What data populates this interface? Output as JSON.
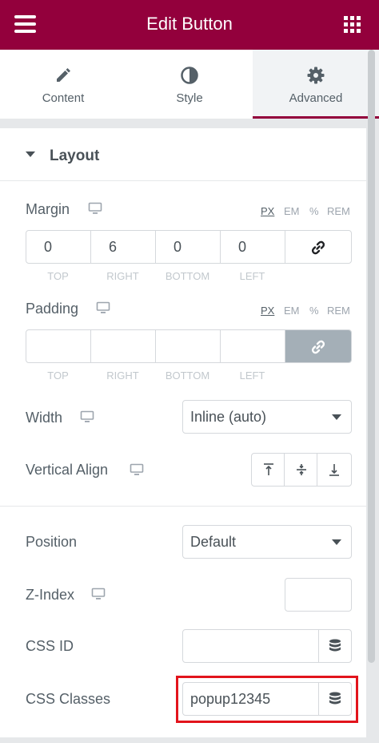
{
  "header": {
    "title": "Edit Button",
    "menu_icon": "hamburger-menu-icon",
    "apps_icon": "grid-apps-icon",
    "background": "#93003c"
  },
  "tabs": [
    {
      "label": "Content",
      "icon": "pencil-icon",
      "active": false
    },
    {
      "label": "Style",
      "icon": "half-circle-icon",
      "active": false
    },
    {
      "label": "Advanced",
      "icon": "gear-icon",
      "active": true
    }
  ],
  "section": {
    "title": "Layout",
    "expanded": true
  },
  "margin": {
    "label": "Margin",
    "units": [
      "PX",
      "EM",
      "%",
      "REM"
    ],
    "active_unit": "PX",
    "values": [
      "0",
      "6",
      "0",
      "0"
    ],
    "sides": [
      "TOP",
      "RIGHT",
      "BOTTOM",
      "LEFT"
    ],
    "linked": false
  },
  "padding": {
    "label": "Padding",
    "units": [
      "PX",
      "EM",
      "%",
      "REM"
    ],
    "active_unit": "PX",
    "values": [
      "",
      "",
      "",
      ""
    ],
    "sides": [
      "TOP",
      "RIGHT",
      "BOTTOM",
      "LEFT"
    ],
    "linked": true
  },
  "width": {
    "label": "Width",
    "value": "Inline (auto)"
  },
  "vertical_align": {
    "label": "Vertical Align",
    "options": [
      "align-top-icon",
      "align-middle-icon",
      "align-bottom-icon"
    ]
  },
  "position": {
    "label": "Position",
    "value": "Default"
  },
  "z_index": {
    "label": "Z-Index",
    "value": ""
  },
  "css_id": {
    "label": "CSS ID",
    "value": ""
  },
  "css_classes": {
    "label": "CSS Classes",
    "value": "popup12345",
    "highlight_color": "#e2141c"
  }
}
